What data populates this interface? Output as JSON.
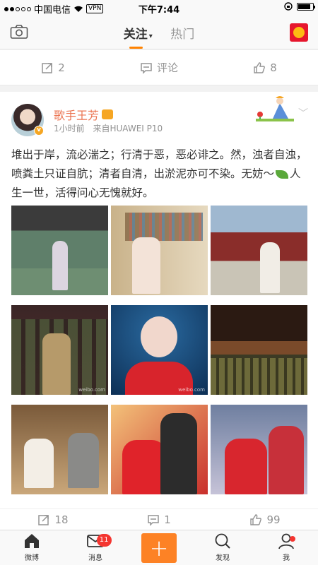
{
  "status": {
    "carrier": "中国电信",
    "vpn": "VPN",
    "time": "下午7:44"
  },
  "nav": {
    "tab_following": "关注",
    "tab_hot": "热门"
  },
  "prev_actions": {
    "repost": "2",
    "comment": "评论",
    "like": "8"
  },
  "post": {
    "username": "歌手王芳",
    "time": "1小时前",
    "source": "来自HUAWEI P10",
    "text_1": "堆出于岸，流必湍之；行清于恶，恶必诽之。然，浊者自浊，喷粪土只证自肮；清者自清，出淤泥亦可不染。无妨～",
    "text_2": "人生一世，活得问心无愧就好。",
    "watermark": "weibo.com"
  },
  "post_actions": {
    "repost": "18",
    "comment": "1",
    "like": "99"
  },
  "tabbar": {
    "home": "微博",
    "messages": "消息",
    "messages_badge": "11",
    "plus": "+",
    "discover": "发现",
    "me": "我"
  },
  "colors": {
    "accent": "#ff8200",
    "username": "#eb7350",
    "badge": "#f43530"
  }
}
